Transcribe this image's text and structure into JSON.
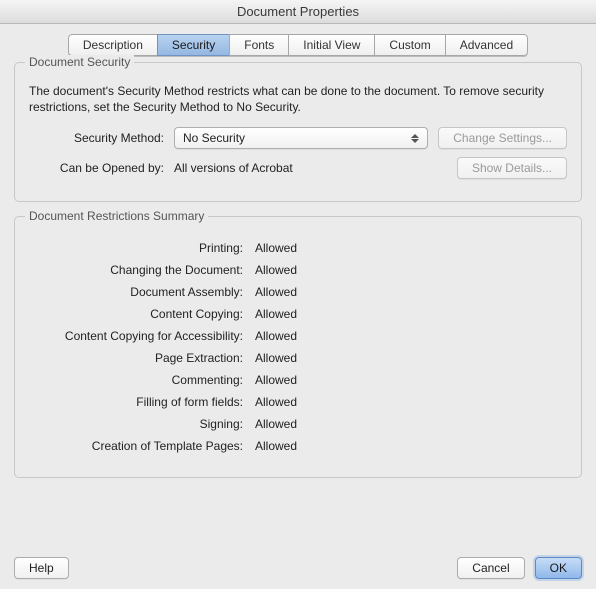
{
  "title": "Document Properties",
  "tabs": [
    "Description",
    "Security",
    "Fonts",
    "Initial View",
    "Custom",
    "Advanced"
  ],
  "active_tab": "Security",
  "security": {
    "group_title": "Document Security",
    "intro": "The document's Security Method restricts what can be done to the document. To remove security restrictions, set the Security Method to No Security.",
    "method_label": "Security Method:",
    "method_value": "No Security",
    "change_settings": "Change Settings...",
    "opened_by_label": "Can be Opened by:",
    "opened_by_value": "All versions of Acrobat",
    "show_details": "Show Details..."
  },
  "restrictions": {
    "group_title": "Document Restrictions Summary",
    "items": [
      {
        "label": "Printing:",
        "value": "Allowed"
      },
      {
        "label": "Changing the Document:",
        "value": "Allowed"
      },
      {
        "label": "Document Assembly:",
        "value": "Allowed"
      },
      {
        "label": "Content Copying:",
        "value": "Allowed"
      },
      {
        "label": "Content Copying for Accessibility:",
        "value": "Allowed"
      },
      {
        "label": "Page Extraction:",
        "value": "Allowed"
      },
      {
        "label": "Commenting:",
        "value": "Allowed"
      },
      {
        "label": "Filling of form fields:",
        "value": "Allowed"
      },
      {
        "label": "Signing:",
        "value": "Allowed"
      },
      {
        "label": "Creation of Template Pages:",
        "value": "Allowed"
      }
    ]
  },
  "footer": {
    "help": "Help",
    "cancel": "Cancel",
    "ok": "OK"
  }
}
